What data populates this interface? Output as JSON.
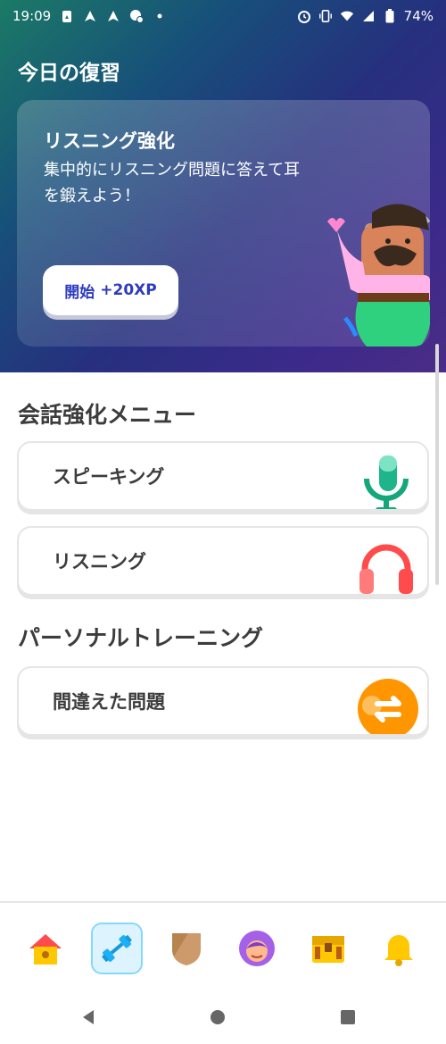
{
  "status_bar": {
    "time": "19:09",
    "battery": "74%",
    "icons": [
      "gallery-icon",
      "nav-icon",
      "nav-icon",
      "dnd-icon",
      "dot-icon",
      "alarm-icon",
      "vibrate-icon",
      "wifi-icon",
      "signal-icon",
      "battery-icon"
    ]
  },
  "hero": {
    "title": "今日の復習",
    "card_title": "リスニング強化",
    "card_desc": "集中的にリスニング問題に答えて耳を鍛えよう！",
    "start_label": "開始",
    "start_xp": "+20XP"
  },
  "sections": {
    "conversation": "会話強化メニュー",
    "personal": "パーソナルトレーニング"
  },
  "menu": {
    "speaking": "スピーキング",
    "listening": "リスニング",
    "mistakes": "間違えた問題"
  },
  "nav": {
    "items": [
      "home-icon",
      "practice-icon",
      "league-icon",
      "profile-icon",
      "shop-icon",
      "notification-icon"
    ],
    "active": "practice"
  },
  "colors": {
    "accent_blue": "#2d3bbf",
    "active_tab_bg": "#ddf4ff",
    "active_tab_border": "#84d8ff",
    "speaking_green": "#1fb58a",
    "listening_red": "#ff4b4b",
    "mistakes_orange": "#ff9600"
  }
}
